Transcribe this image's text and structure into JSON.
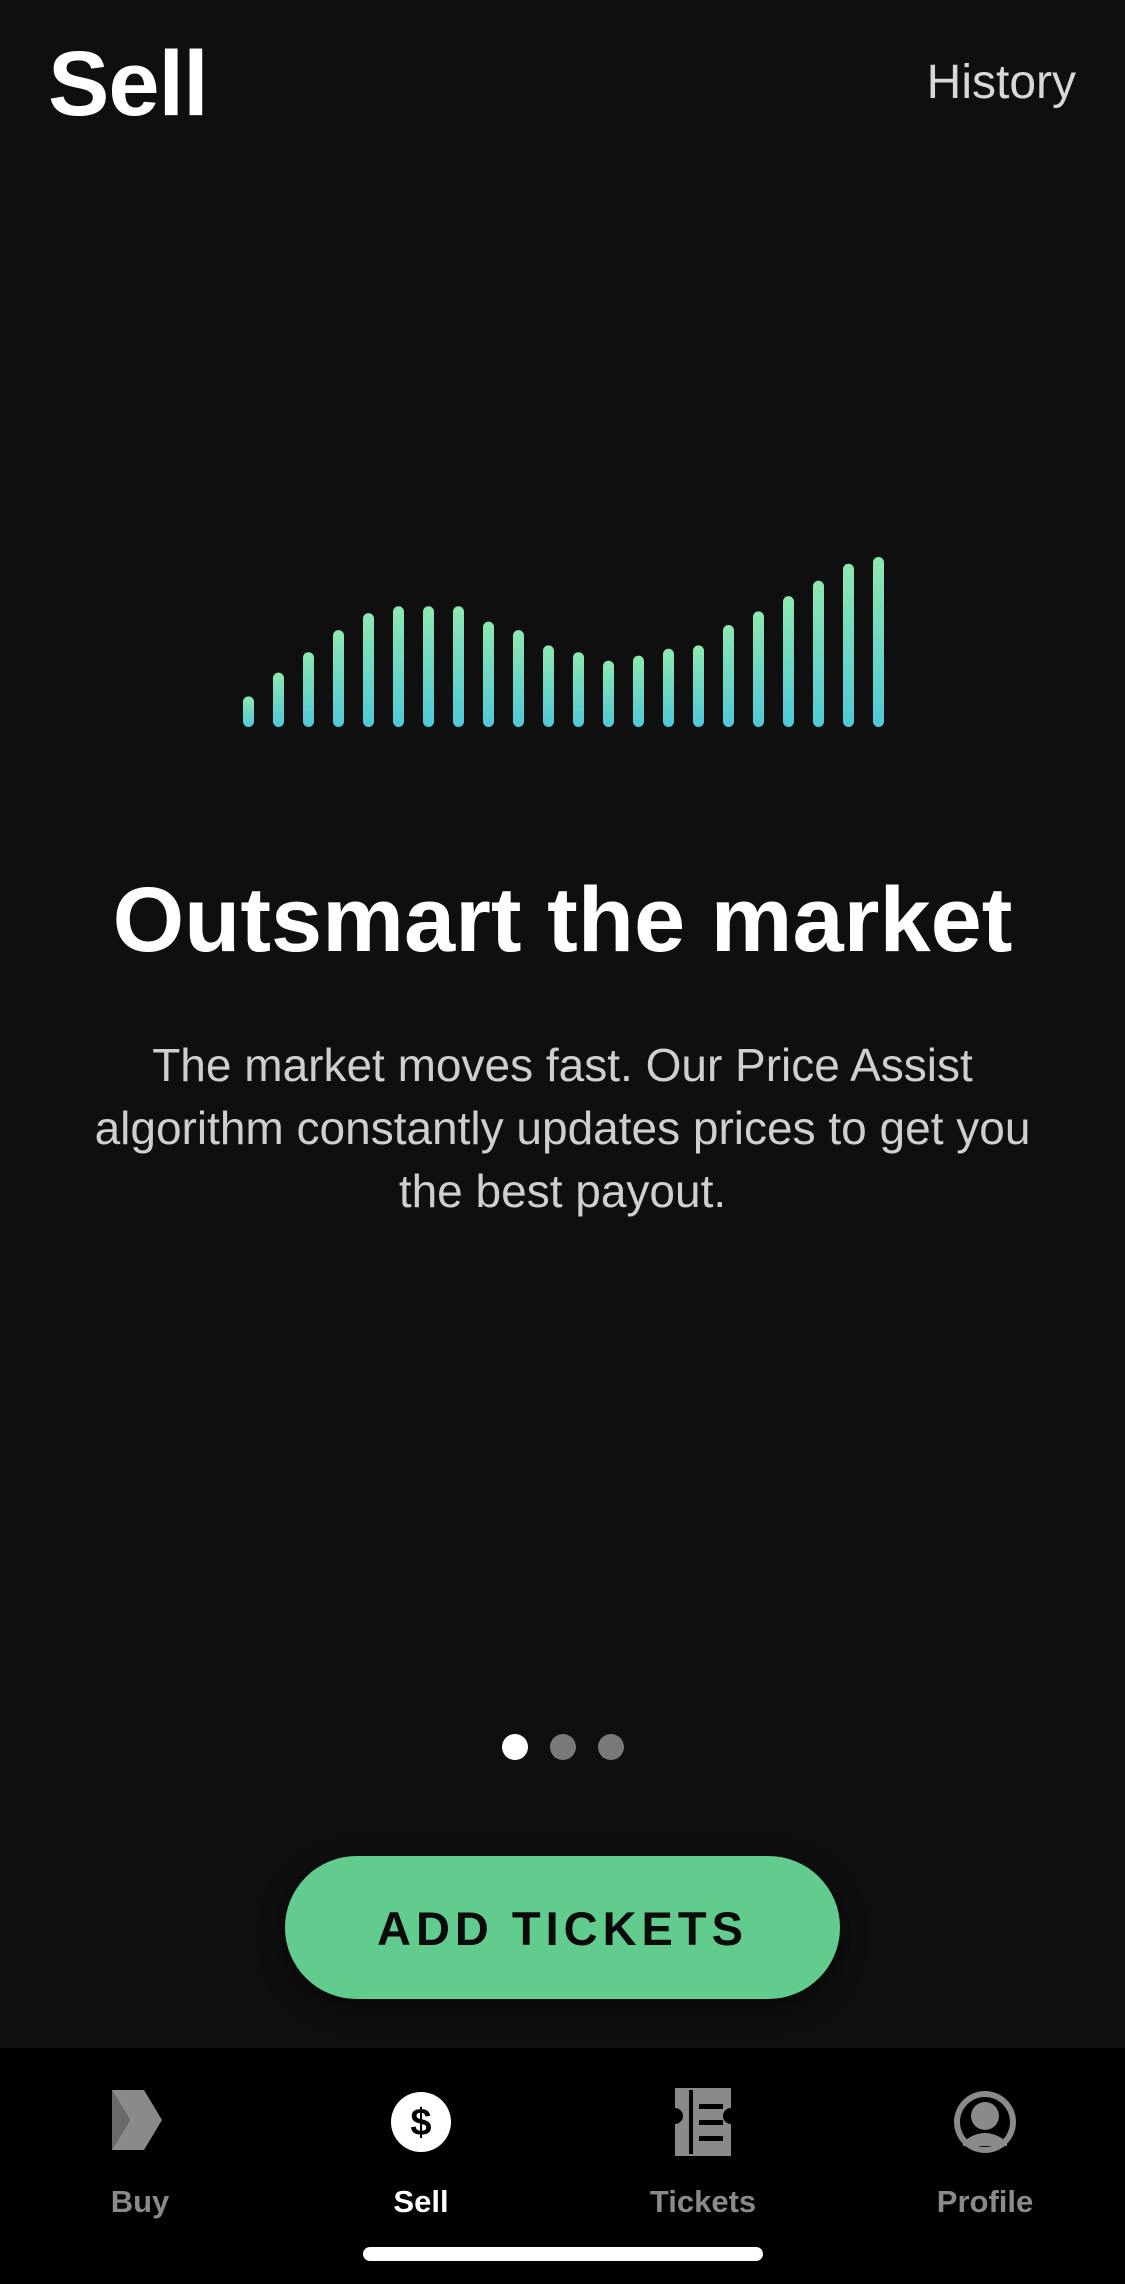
{
  "header": {
    "title": "Sell",
    "history_label": "History"
  },
  "onboarding": {
    "headline": "Outsmart the market",
    "description": "The market moves fast. Our Price Assist algorithm constantly updates prices to get you the best payout.",
    "illustration": {
      "icon": "price-bars-illustration",
      "bar_levels": [
        0.18,
        0.32,
        0.44,
        0.57,
        0.67,
        0.71,
        0.71,
        0.71,
        0.62,
        0.57,
        0.48,
        0.44,
        0.39,
        0.42,
        0.46,
        0.48,
        0.6,
        0.68,
        0.77,
        0.86,
        0.96,
        1.0
      ],
      "gradient_top": "#8ee8b0",
      "gradient_bottom": "#4fc8d8"
    },
    "pager": {
      "total": 3,
      "active_index": 0
    }
  },
  "cta": {
    "add_tickets_label": "ADD TICKETS",
    "color": "#62cc8f"
  },
  "tabbar": {
    "items": [
      {
        "label": "Buy",
        "icon": "chevron-arrow-icon",
        "active": false
      },
      {
        "label": "Sell",
        "icon": "dollar-circle-icon",
        "active": true
      },
      {
        "label": "Tickets",
        "icon": "ticket-icon",
        "active": false
      },
      {
        "label": "Profile",
        "icon": "profile-icon",
        "active": false
      }
    ]
  },
  "colors": {
    "background": "#0f0f0f",
    "tabbar_background": "#000000",
    "inactive_tab": "#8a8a8a",
    "active_tab": "#ffffff"
  }
}
